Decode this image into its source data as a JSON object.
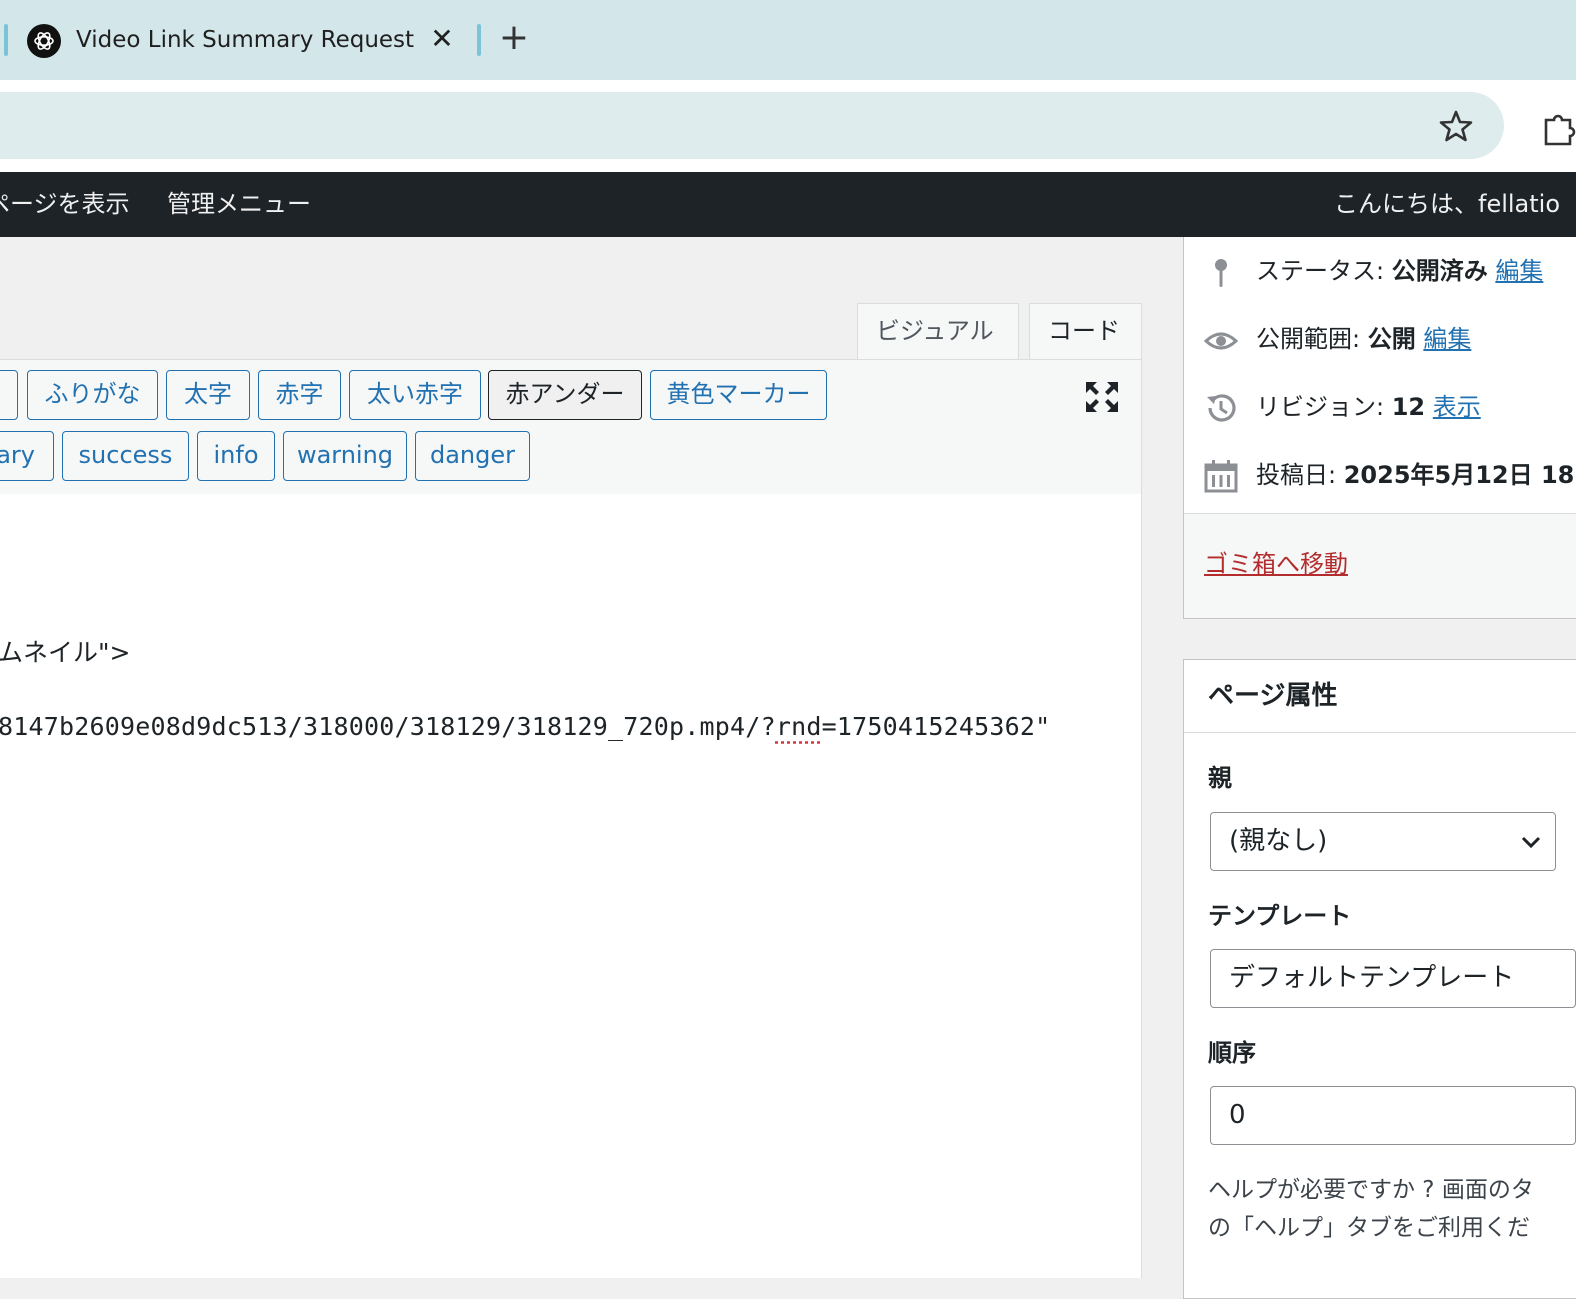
{
  "browser": {
    "tab_title": "Video Link Summary Request",
    "tab_close": "✕",
    "new_tab": "+"
  },
  "adminbar": {
    "view_page": "ページを表示",
    "admin_menu": "管理メニュー",
    "greeting": "こんにちは、fellatio"
  },
  "editor": {
    "tab_visual": "ビジュアル",
    "tab_code": "コード",
    "buttons_row1": [
      "ふりがな",
      "太字",
      "赤字",
      "太い赤字",
      "赤アンダー",
      "黄色マーカー"
    ],
    "buttons_row2": [
      "ary",
      "success",
      "info",
      "warning",
      "danger"
    ],
    "line1": "ムネイル\">",
    "line2_a": "8147b2609e08d9dc513/318000/318129/318129_720p.mp4/?",
    "line2_b": "rnd",
    "line2_c": "=1750415245362\""
  },
  "publish": {
    "status_label": "ステータス: ",
    "status_value": "公開済み",
    "status_edit": "編集",
    "visibility_label": "公開範囲: ",
    "visibility_value": "公開",
    "visibility_edit": "編集",
    "revision_label": "リビジョン: ",
    "revision_value": "12",
    "revision_link": "表示",
    "date_label": "投稿日: ",
    "date_value": "2025年5月12日 18",
    "trash": "ゴミ箱へ移動"
  },
  "page_attributes": {
    "title": "ページ属性",
    "parent_label": "親",
    "parent_value": "(親なし)",
    "template_label": "テンプレート",
    "template_value": "デフォルトテンプレート",
    "order_label": "順序",
    "order_value": "0",
    "help_line1": "ヘルプが必要ですか ? 画面のタ",
    "help_line2": "の「ヘルプ」タブをご利用くだ"
  },
  "colors": {
    "accent": "#2271b1",
    "adminbar": "#1d2327",
    "danger": "#b32d2e",
    "tabbar": "#d3e6ea"
  }
}
